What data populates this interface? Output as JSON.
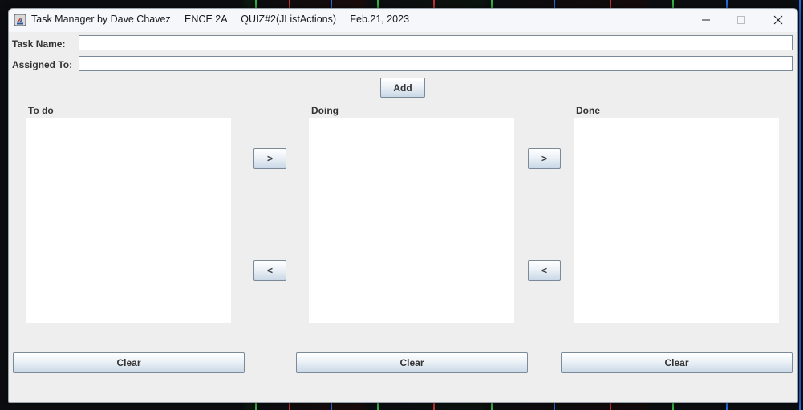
{
  "window": {
    "title": "Task Manager by Dave Chavez     ENCE 2A     QUIZ#2(JListActions)     Feb.21, 2023"
  },
  "form": {
    "task_name_label": "Task Name:",
    "task_name_value": "",
    "assigned_to_label": "Assigned To:",
    "assigned_to_value": "",
    "add_label": "Add"
  },
  "columns": {
    "todo_label": "To do",
    "doing_label": "Doing",
    "done_label": "Done"
  },
  "moves": {
    "forward_label": ">",
    "back_label": "<"
  },
  "footer": {
    "clear_label": "Clear"
  },
  "icons": {
    "app": "java-app-icon",
    "minimize": "minimize-icon",
    "maximize": "maximize-icon",
    "close": "close-icon"
  },
  "colors": {
    "window_bg": "#eeeeee",
    "list_bg": "#ffffff",
    "button_border": "#7a8a99"
  }
}
